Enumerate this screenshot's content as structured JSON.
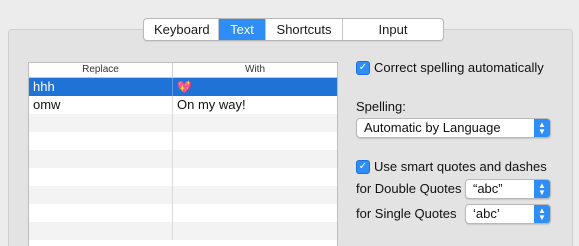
{
  "tabs": [
    {
      "label": "Keyboard",
      "active": false
    },
    {
      "label": "Text",
      "active": true
    },
    {
      "label": "Shortcuts",
      "active": false
    },
    {
      "label": "Input Sources",
      "active": false
    }
  ],
  "table": {
    "headers": {
      "replace": "Replace",
      "with": "With"
    },
    "rows": [
      {
        "replace": "hhh",
        "with": "💖",
        "selected": true
      },
      {
        "replace": "omw",
        "with": "On my way!",
        "selected": false
      }
    ]
  },
  "options": {
    "correct_spelling": {
      "label": "Correct spelling automatically",
      "checked": true
    },
    "spelling_label": "Spelling:",
    "spelling_value": "Automatic by Language",
    "smart_quotes": {
      "label": "Use smart quotes and dashes",
      "checked": true
    },
    "double_quotes_label": "for Double Quotes",
    "double_quotes_value": "“abc”",
    "single_quotes_label": "for Single Quotes",
    "single_quotes_value": "‘abc’"
  },
  "colors": {
    "accent": "#2f8df6",
    "selection": "#1f72d6"
  }
}
